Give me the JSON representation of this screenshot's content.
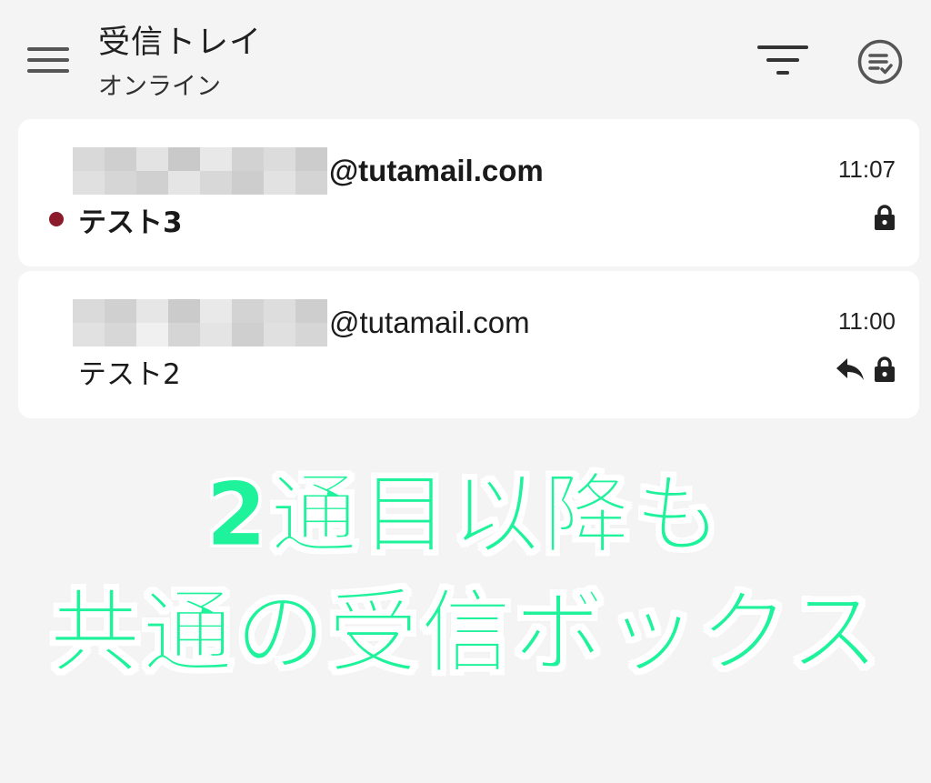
{
  "header": {
    "title": "受信トレイ",
    "subtitle": "オンライン",
    "menu_icon": "hamburger-menu-icon",
    "filter_icon": "filter-icon",
    "select_icon": "multi-select-checklist-icon"
  },
  "mails": [
    {
      "sender_domain": "@tutamail.com",
      "sender_name_redacted": true,
      "subject": "テスト3",
      "time": "11:07",
      "unread": true,
      "icons": [
        "lock-icon"
      ]
    },
    {
      "sender_domain": "@tutamail.com",
      "sender_name_redacted": true,
      "subject": "テスト2",
      "time": "11:00",
      "unread": false,
      "icons": [
        "reply-icon",
        "lock-icon"
      ]
    }
  ],
  "caption": {
    "line1": "2通目以降も",
    "line2": "共通の受信ボックス"
  },
  "colors": {
    "background": "#f4f4f4",
    "card": "#ffffff",
    "unread_dot": "#8b1a2b",
    "caption_fill": "#1ef29b",
    "caption_outline": "#ffffff"
  }
}
